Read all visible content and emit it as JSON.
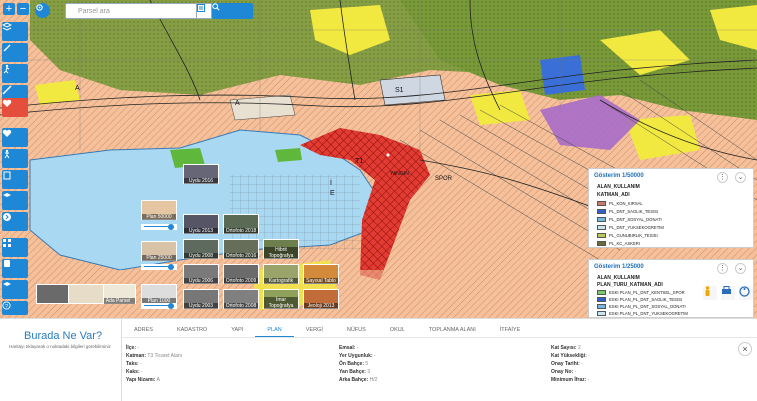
{
  "map": {
    "labels": {
      "h1": "1/50000",
      "a1": "A",
      "a2": "A",
      "s1": "S1",
      "i1": "İ",
      "e1": "E",
      "tl": "T1",
      "fire_label": "YANGIN",
      "spor": "SPOR"
    },
    "colors": {
      "water": "#a9d9f2",
      "residential": "#f5c09a",
      "forest": "#7a9a3a",
      "yellow": "#f2e940",
      "red": "#e23b32",
      "purple": "#a86bc9",
      "blue": "#3a6fd8"
    }
  },
  "toolbar": {
    "zoom_in": "+",
    "zoom_out": "−",
    "search_placeholder": "Parsel ara",
    "go_icon": "search-icon",
    "tools": [
      "layers-icon",
      "draw-icon",
      "walk-icon",
      "ruler-icon",
      "heart-icon",
      "health-icon",
      "person-icon",
      "building-icon",
      "school-icon",
      "arrow-icon",
      "grid-icon",
      "bus-icon",
      "school-alt-icon",
      "wheelchair-icon",
      "help-icon"
    ]
  },
  "thumbs": [
    {
      "label": "Uydu 2016"
    },
    {
      "label": "Plan 50000"
    },
    {
      "label": "Uydu 2013"
    },
    {
      "label": "Ortofoto 2018"
    },
    {
      "label": "Plan 25000"
    },
    {
      "label": "Uydu 2008"
    },
    {
      "label": "Ortofoto 2016"
    },
    {
      "label": "Hibrit Topoğrafya"
    },
    {
      "label": "Plan 1000"
    },
    {
      "label": "Uydu 2006"
    },
    {
      "label": "Ortofoto 2009"
    },
    {
      "label": "Kartografik"
    },
    {
      "label": "Sayısal Tablo"
    },
    {
      "label": "Ada Parsel"
    },
    {
      "label": "Uydu 2003"
    },
    {
      "label": "Ortofoto 2008"
    },
    {
      "label": "İmar Topoğrafya"
    },
    {
      "label": "Jeoloji 2013"
    }
  ],
  "legend50": {
    "title": "Gösterim 1/50000",
    "sub1": "ALAN_KULLANIM",
    "sub2": "KATMAN_ADI",
    "rows": [
      {
        "label": "PL_KON_KIRSAL",
        "color": "#c97a6a"
      },
      {
        "label": "PL_DNT_SAGLIK_TESISI",
        "color": "#2e62c9"
      },
      {
        "label": "PL_DNT_SOSYAL_DONATI",
        "color": "#78b8e0"
      },
      {
        "label": "PL_DNT_YUKSEKOGRETIM",
        "color": "#c8e6f2"
      },
      {
        "label": "PL_GUNUBIRLIK_TESISI",
        "color": "#b9c95c"
      },
      {
        "label": "PL_KC_ASKERI",
        "color": "#6b6b3a"
      }
    ]
  },
  "legend25": {
    "title": "Gösterim 1/25000",
    "sub1": "ALAN_KULLANIM",
    "sub2": "PLAN_TURU_KATMAN_ADI",
    "rows": [
      {
        "label": "ESKI PLAN_PL_DNT_KENTSEL_SPOR",
        "color": "#7bc96f"
      },
      {
        "label": "ESKI PLAN_PL_DNT_SAGLIK_TESISI",
        "color": "#2e62c9"
      },
      {
        "label": "ESKI PLAN_PL_DNT_SOSYAL_DONATI",
        "color": "#78b8e0"
      },
      {
        "label": "ESKI PLAN_PL_DNT_YUKSEKOGRETIM",
        "color": "#c8e6f2"
      }
    ]
  },
  "bottom": {
    "title": "Burada Ne Var?",
    "desc": "Haritayı tıklayarak o noktadaki bilgileri görebilirsiniz",
    "tabs": [
      "ADRES",
      "KADASTRO",
      "YAPI",
      "PLAN",
      "VERGİ",
      "NÜFUS",
      "OKUL",
      "TOPLANMA ALANI",
      "İTFAİYE"
    ],
    "active_tab": "PLAN",
    "col1": [
      {
        "k": "İlçe:",
        "v": "-"
      },
      {
        "k": "Katman:",
        "v": "T3 Ticaret Alanı"
      },
      {
        "k": "Taks:",
        "v": "-"
      },
      {
        "k": "Kaks:",
        "v": "-"
      },
      {
        "k": "Yapı Nizamı:",
        "v": "A"
      }
    ],
    "col2": [
      {
        "k": "Emsal:",
        "v": "-"
      },
      {
        "k": "Yer Uygunluk:",
        "v": "-"
      },
      {
        "k": "Ön Bahçe:",
        "v": "5"
      },
      {
        "k": "Yan Bahçe:",
        "v": "3"
      },
      {
        "k": "Arka Bahçe:",
        "v": "H/2"
      }
    ],
    "col3": [
      {
        "k": "Kat Sayısı:",
        "v": "2"
      },
      {
        "k": "Kat Yüksekliği:",
        "v": "-"
      },
      {
        "k": "Onay Tarihi:",
        "v": "-"
      },
      {
        "k": "Onay No:",
        "v": "-"
      },
      {
        "k": "Minimum İfraz:",
        "v": "-"
      }
    ],
    "close": "×"
  }
}
